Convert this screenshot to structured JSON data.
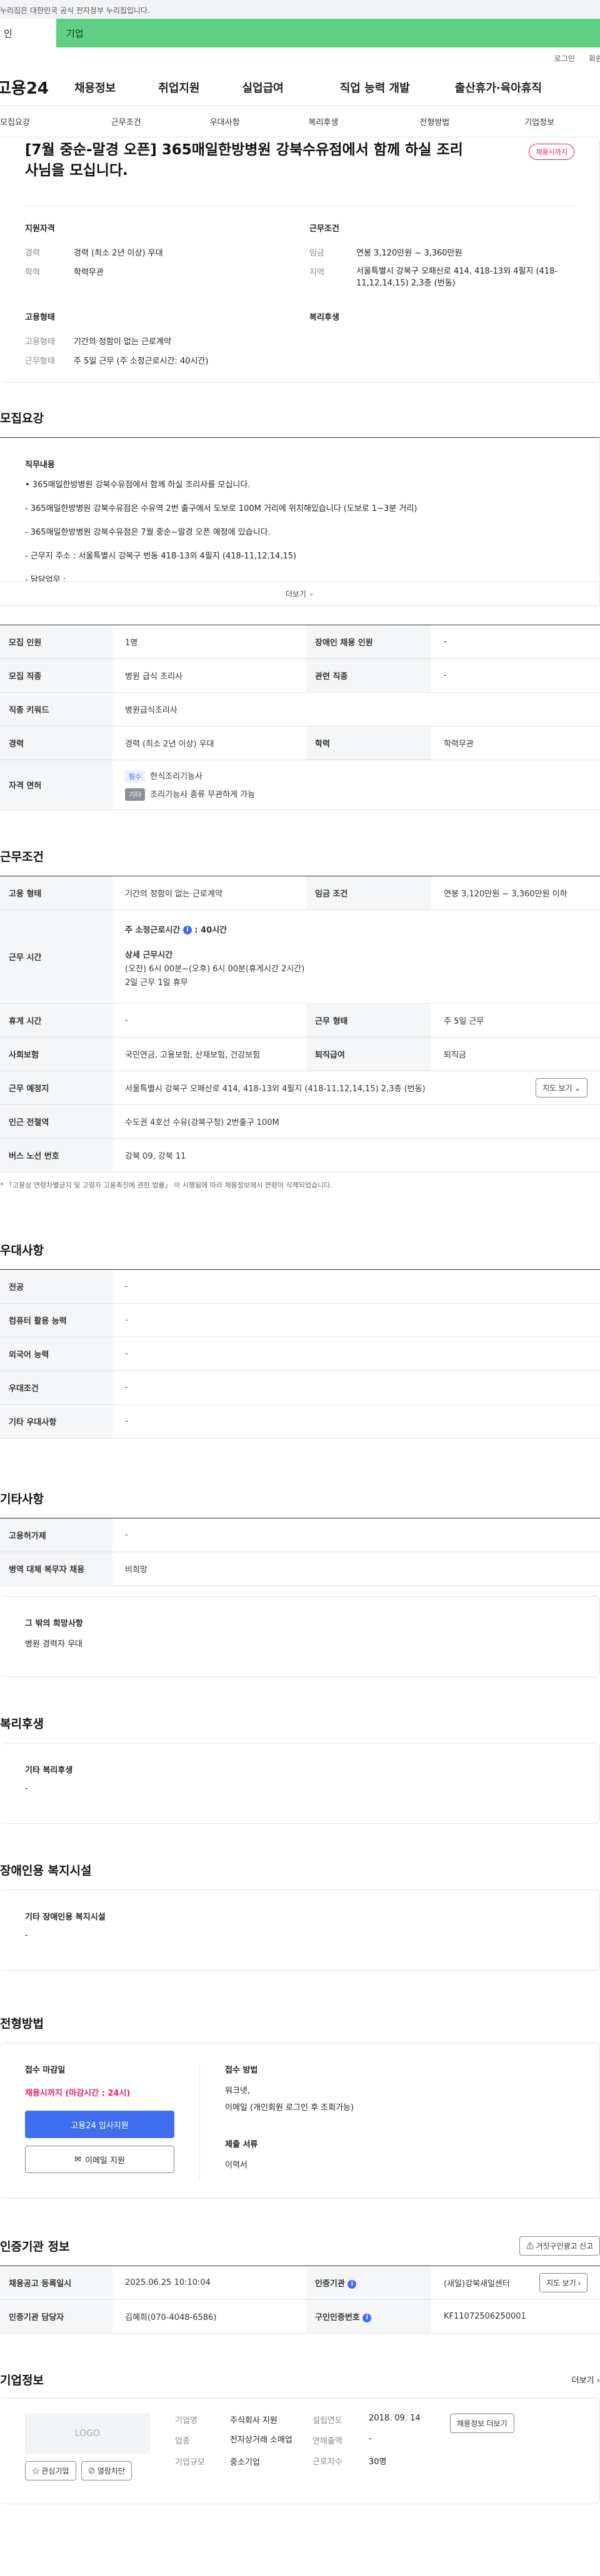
{
  "gov_bar": {
    "text": "누리집은 대한민국 공식 전자정부 누리집입니다."
  },
  "user_tabs": {
    "person": "인",
    "company": "기업"
  },
  "util": {
    "login": "로그인",
    "join": "회원"
  },
  "gnb": {
    "logo": "고용24",
    "menus": [
      "채용정보",
      "취업지원",
      "실업급여",
      "직업 능력 개발",
      "출산휴가·육아휴직"
    ]
  },
  "tabs": [
    "모집요강",
    "근무조건",
    "우대사항",
    "복리후생",
    "전형방법",
    "기업정보"
  ],
  "header": {
    "title": "[7월 중순-말경 오픈] 365매일한방병원 강북수유점에서 함께 하실 조리사님을 모십니다.",
    "badge": "채용시까지",
    "qual_title": "지원자격",
    "career_label": "경력",
    "career_value": "경력 (최소 2년 이상) 우대",
    "edu_label": "학력",
    "edu_value": "학력무관",
    "cond_title": "근무조건",
    "wage_label": "임금",
    "wage_value": "연봉 3,120만원 ~ 3,360만원",
    "region_label": "지역",
    "region_value": "서울특별시 강북구 오패산로 414, 418-13외 4필지 (418-11,12,14,15) 2,3층 (번동)",
    "emp_title": "고용형태",
    "emptype_label": "고용형태",
    "emptype_value": "기간의 정함이 없는 근로계약",
    "worktype_label": "근무형태",
    "worktype_value": "주 5일 근무 (주 소정근로시간: 40시간)",
    "welfare_title": "복리후생"
  },
  "recruit": {
    "title": "모집요강",
    "job_label": "직무내용",
    "lines": [
      "• 365매일한방병원 강북수유점에서 함께 하실 조리사를 모십니다.",
      "- 365매일한방병원 강북수유점은 수유역 2번 출구에서 도보로 100M 거리에 위치해있습니다 (도보로 1~3분 거리)",
      "- 365매일한방병원 강북수유점은 7월 중순~말경 오픈 예정에 있습니다.",
      "- 근무지 주소 : 서울특별시 강북구 번동 418-13외 4필지 (418-11,12,14,15)",
      "- 담당업무 :"
    ],
    "more": "더보기",
    "rows": {
      "headcount_label": "모집 인원",
      "headcount_value": "1명",
      "disabled_label": "장애인 채용 인원",
      "disabled_value": "-",
      "job_label": "모집 직종",
      "job_value": "병원 급식 조리사",
      "related_label": "관련 직종",
      "related_value": "-",
      "keyword_label": "직종 키워드",
      "keyword_value": "병원급식조리사",
      "career_label": "경력",
      "career_value": "경력 (최소 2년 이상) 우대",
      "edu_label": "학력",
      "edu_value": "학력무관",
      "license_label": "자격 면허",
      "license1_tag": "필수",
      "license1_value": "한식조리기능사",
      "license2_tag": "기타",
      "license2_value": "조리기능사 종류 무관하게 가능"
    }
  },
  "workcond": {
    "title": "근무조건",
    "emptype_label": "고용 형태",
    "emptype_value": "기간의 정함이 없는 근로계약",
    "wage_label": "임금 조건",
    "wage_value": "연봉 3,120만원 ~ 3,360만원 이하",
    "hours_label": "근무 시간",
    "hours_weekly_label": "주 소정근로시간",
    "hours_weekly_value": "40시간",
    "hours_detail_label": "상세 근무시간",
    "hours_detail_1": "(오전) 6시 00분~(오후) 6시 00분(휴게시간 2시간)",
    "hours_detail_2": "2일 근무 1일 휴무",
    "break_label": "휴게 시간",
    "break_value": "-",
    "workform_label": "근무 형태",
    "workform_value": "주 5일 근무",
    "insurance_label": "사회보험",
    "insurance_value": "국민연금, 고용보험, 산재보험, 건강보험",
    "retire_label": "퇴직급여",
    "retire_value": "퇴직금",
    "place_label": "근무 예정지",
    "place_value": "서울특별시 강북구 오패산로 414, 418-13외 4필지 (418-11,12,14,15) 2,3층 (번동)",
    "map_btn": "지도 보기",
    "subway_label": "인근 전철역",
    "subway_value": "수도권 4호선 수유(강북구청) 2번출구 100M",
    "bus_label": "버스 노선 번호",
    "bus_value": "강북 09, 강북 11",
    "note": "* 「고용상 연령차별금지 및 고령자 고용촉진에 관한 법률」 이 시행됨에 따라 채용정보에서 연령이 삭제되었습니다."
  },
  "pref": {
    "title": "우대사항",
    "major_label": "전공",
    "major_value": "-",
    "computer_label": "컴퓨터 활용 능력",
    "computer_value": "-",
    "lang_label": "외국어 능력",
    "lang_value": "-",
    "cond_label": "우대조건",
    "cond_value": "-",
    "etc_label": "기타 우대사항",
    "etc_value": "-"
  },
  "etc": {
    "title": "기타사항",
    "disability_label": "고용허가제",
    "disability_value": "-",
    "military_label": "병역 대체 복무자 채용",
    "military_value": "비희망",
    "extra_label": "그 밖의 희망사항",
    "extra_value": "병원 경력자 우대"
  },
  "welfare": {
    "title": "복리후생",
    "label": "기타 복리후생",
    "value": "-"
  },
  "disability_fac": {
    "title": "장애인용 복지시설",
    "label": "기타 장애인용 복지시설",
    "value": "-"
  },
  "screening": {
    "title": "전형방법",
    "deadline_label": "접수 마감일",
    "deadline_value": "채용시까지 (마감시간 : 24시)",
    "apply_btn": "고용24 입사지원",
    "email_btn": "이메일 지원",
    "method_label": "접수 방법",
    "method_1": "워크넷,",
    "method_2": "이메일 (개인회원 로그인 후 조회가능)",
    "docs_label": "제출 서류",
    "docs_value": "이력서"
  },
  "cert": {
    "title": "인증기관 정보",
    "report_btn": "거짓구인광고 신고",
    "reg_label": "채용공고 등록일시",
    "reg_value": "2025.06.25 10:10:04",
    "org_label": "인증기관",
    "org_value": "(새일)강북새일센터",
    "map_btn": "지도 보기",
    "mgr_label": "인증기관 담당자",
    "mgr_value": "김혜희(070-4048-6586)",
    "no_label": "구인인증번호",
    "no_value": "KF11072506250001"
  },
  "company": {
    "title": "기업정보",
    "more": "더보기",
    "logo": "LOGO",
    "fav_btn": "관심기업",
    "follow_btn": "열람차단",
    "name_label": "기업명",
    "name_value": "주식회사 지원",
    "industry_label": "업종",
    "industry_value": "전자상거래 소매업",
    "size_label": "기업규모",
    "size_value": "중소기업",
    "founded_label": "설립연도",
    "founded_value": "2018. 09. 14",
    "sales_label": "연매출액",
    "sales_value": "-",
    "emp_label": "근로자수",
    "emp_value": "30명",
    "jobs_btn": "채용정보 더보기"
  }
}
